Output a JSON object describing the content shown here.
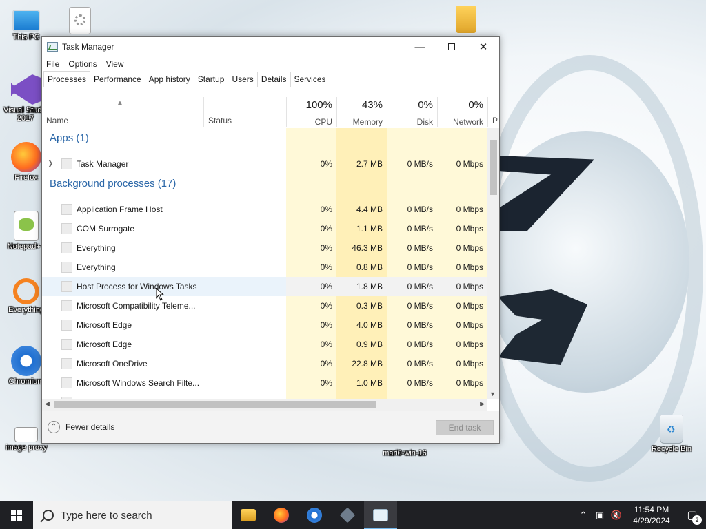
{
  "desktop": {
    "icons": [
      {
        "label": "This PC"
      },
      {
        "label": ""
      },
      {
        "label": "Visual Studio 2017"
      },
      {
        "label": "Firefox"
      },
      {
        "label": "Notepad++"
      },
      {
        "label": "Everything"
      },
      {
        "label": "Chromium"
      },
      {
        "label": "image proxy"
      },
      {
        "label": "mari0-win-16"
      },
      {
        "label": "Recycle Bin"
      }
    ]
  },
  "window": {
    "title": "Task Manager",
    "menu": [
      "File",
      "Options",
      "View"
    ],
    "tabs": [
      "Processes",
      "Performance",
      "App history",
      "Startup",
      "Users",
      "Details",
      "Services"
    ],
    "active_tab": "Processes"
  },
  "columns": {
    "name": "Name",
    "status": "Status",
    "cpu": {
      "label": "CPU",
      "pct": "100%"
    },
    "memory": {
      "label": "Memory",
      "pct": "43%"
    },
    "disk": {
      "label": "Disk",
      "pct": "0%"
    },
    "network": {
      "label": "Network",
      "pct": "0%"
    },
    "more": "P"
  },
  "groups": {
    "apps": "Apps (1)",
    "background": "Background processes (17)"
  },
  "apps": [
    {
      "name": "Task Manager",
      "cpu": "0%",
      "mem": "2.7 MB",
      "disk": "0 MB/s",
      "net": "0 Mbps"
    }
  ],
  "background": [
    {
      "name": "Application Frame Host",
      "cpu": "0%",
      "mem": "4.4 MB",
      "disk": "0 MB/s",
      "net": "0 Mbps"
    },
    {
      "name": "COM Surrogate",
      "cpu": "0%",
      "mem": "1.1 MB",
      "disk": "0 MB/s",
      "net": "0 Mbps"
    },
    {
      "name": "Everything",
      "cpu": "0%",
      "mem": "46.3 MB",
      "disk": "0 MB/s",
      "net": "0 Mbps"
    },
    {
      "name": "Everything",
      "cpu": "0%",
      "mem": "0.8 MB",
      "disk": "0 MB/s",
      "net": "0 Mbps"
    },
    {
      "name": "Host Process for Windows Tasks",
      "cpu": "0%",
      "mem": "1.8 MB",
      "disk": "0 MB/s",
      "net": "0 Mbps"
    },
    {
      "name": "Microsoft Compatibility Teleme...",
      "cpu": "0%",
      "mem": "0.3 MB",
      "disk": "0 MB/s",
      "net": "0 Mbps"
    },
    {
      "name": "Microsoft Edge",
      "cpu": "0%",
      "mem": "4.0 MB",
      "disk": "0 MB/s",
      "net": "0 Mbps"
    },
    {
      "name": "Microsoft Edge",
      "cpu": "0%",
      "mem": "0.9 MB",
      "disk": "0 MB/s",
      "net": "0 Mbps"
    },
    {
      "name": "Microsoft OneDrive",
      "cpu": "0%",
      "mem": "22.8 MB",
      "disk": "0 MB/s",
      "net": "0 Mbps"
    },
    {
      "name": "Microsoft Windows Search Filte...",
      "cpu": "0%",
      "mem": "1.0 MB",
      "disk": "0 MB/s",
      "net": "0 Mbps"
    }
  ],
  "footer": {
    "fewer_details": "Fewer details",
    "end_task": "End task"
  },
  "taskbar": {
    "search_placeholder": "Type here to search",
    "time": "11:54 PM",
    "date": "4/29/2024",
    "notification_count": "2"
  },
  "colors": {
    "group_blue": "#2b67a8",
    "heat_light": "#fff9d8",
    "heat_mid": "#fff0b8",
    "taskbar": "#1f2024",
    "accent": "#76b9ed"
  }
}
